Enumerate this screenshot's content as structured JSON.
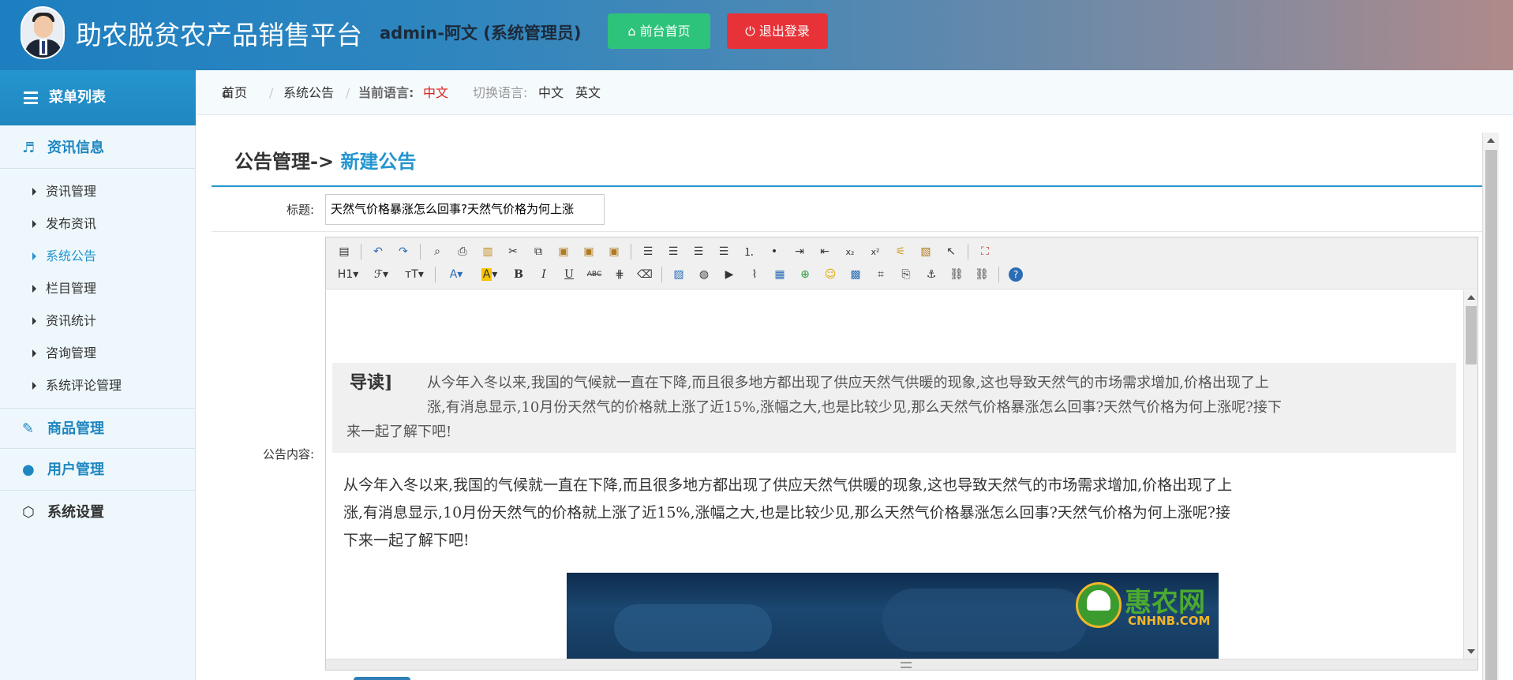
{
  "header": {
    "site_title": "助农脱贫农产品销售平台",
    "admin_text": "admin-阿文 (系统管理员)",
    "home_button": "前台首页",
    "logout_button": "退出登录"
  },
  "sidebar": {
    "menu_title": "菜单列表",
    "section_info": "资讯信息",
    "items": [
      "资讯管理",
      "发布资讯",
      "系统公告",
      "栏目管理",
      "资讯统计",
      "咨询管理",
      "系统评论管理"
    ],
    "active_item": "系统公告",
    "section_goods": "商品管理",
    "section_users": "用户管理",
    "section_settings": "系统设置"
  },
  "breadcrumb": {
    "home": "首页",
    "sep": "/",
    "current": "系统公告",
    "lang_label": "当前语言:",
    "lang_value": "中文",
    "switch_label": "切换语言:",
    "switch_cn": "中文",
    "switch_en": "英文"
  },
  "panel": {
    "title_prefix": "公告管理->",
    "title_highlight": "新建公告",
    "title_label": "标题:",
    "title_value": "天然气价格暴涨怎么回事?天然气价格为何上涨",
    "content_label": "公告内容:"
  },
  "editor": {
    "toolbar_row2": {
      "heading": "H1",
      "bold": "B",
      "italic": "I",
      "underline": "U",
      "strike": "ABC"
    },
    "quote_tag": "导读]",
    "quote_line1": "从今年入冬以来,我国的气候就一直在下降,而且很多地方都出现了供应天然气供暖的现象,这也导致天然气的市场需求增加,价格出现了上",
    "quote_line2": "涨,有消息显示,10月份天然气的价格就上涨了近15%,涨幅之大,也是比较少见,那么天然气价格暴涨怎么回事?天然气价格为何上涨呢?接下",
    "quote_line3": "来一起了解下吧!",
    "para_line1": "从今年入冬以来,我国的气候就一直在下降,而且很多地方都出现了供应天然气供暖的现象,这也导致天然气的市场需求增加,价格出现了上",
    "para_line2": "涨,有消息显示,10月份天然气的价格就上涨了近15%,涨幅之大,也是比较少见,那么天然气价格暴涨怎么回事?天然气价格为何上涨呢?接",
    "para_line3": "下来一起了解下吧!",
    "image_logo_cn": "惠农网",
    "image_logo_en": "CNHNB.COM"
  }
}
